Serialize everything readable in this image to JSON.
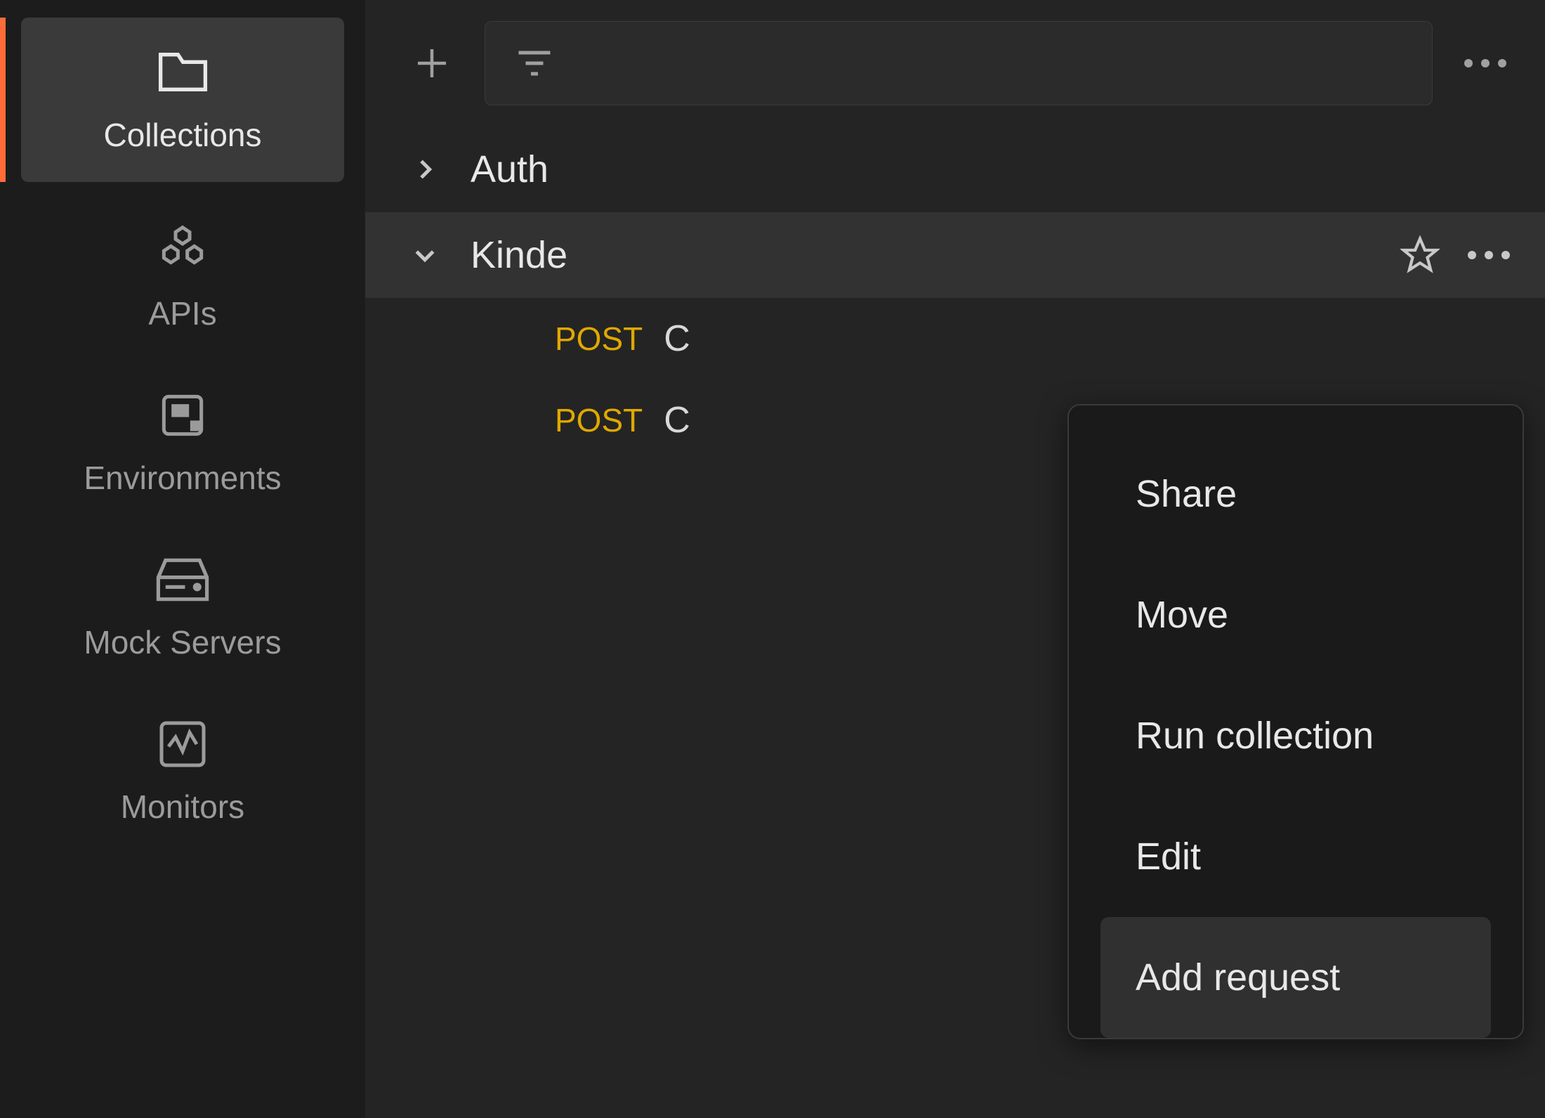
{
  "sidebar": {
    "items": [
      {
        "label": "Collections"
      },
      {
        "label": "APIs"
      },
      {
        "label": "Environments"
      },
      {
        "label": "Mock Servers"
      },
      {
        "label": "Monitors"
      }
    ]
  },
  "collections": [
    {
      "name": "Auth",
      "expanded": false
    },
    {
      "name": "Kinde",
      "expanded": true
    }
  ],
  "requests": [
    {
      "method": "POST",
      "name": "C"
    },
    {
      "method": "POST",
      "name": "C"
    }
  ],
  "context_menu": {
    "items": [
      {
        "label": "Share"
      },
      {
        "label": "Move"
      },
      {
        "label": "Run collection"
      },
      {
        "label": "Edit"
      },
      {
        "label": "Add request",
        "highlighted": true
      }
    ]
  },
  "colors": {
    "accent": "#ff6c37",
    "method_post": "#e0a800",
    "bg_dark": "#1c1c1c",
    "bg_panel": "#242424"
  }
}
